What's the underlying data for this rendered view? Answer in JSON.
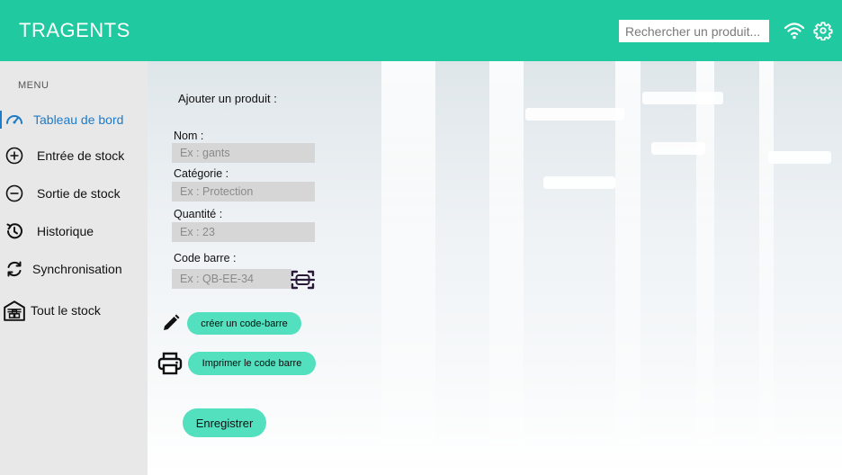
{
  "app": {
    "title": "TRAGENTS"
  },
  "header": {
    "search_placeholder": "Rechercher un produit...",
    "wifi_icon": "wifi-icon",
    "settings_icon": "gear-icon"
  },
  "sidebar": {
    "menu_title": "MENU",
    "items": [
      {
        "label": "Tableau de bord",
        "icon": "dashboard-gauge-icon",
        "active": true
      },
      {
        "label": "Entrée de stock",
        "icon": "plus-circle-icon"
      },
      {
        "label": "Sortie de stock",
        "icon": "minus-circle-icon"
      },
      {
        "label": "Historique",
        "icon": "history-icon"
      },
      {
        "label": "Synchronisation",
        "icon": "sync-icon"
      },
      {
        "label": "Tout le stock",
        "icon": "warehouse-icon"
      }
    ]
  },
  "form": {
    "title": "Ajouter un produit :",
    "name_label": "Nom :",
    "name_placeholder": "Ex : gants",
    "category_label": "Catégorie :",
    "category_placeholder": "Ex : Protection",
    "quantity_label": "Quantité :",
    "quantity_placeholder": "Ex : 23",
    "barcode_label": "Code barre :",
    "barcode_placeholder": "Ex : QB-EE-34",
    "create_barcode_label": "créer un code-barre",
    "print_barcode_label": "Imprimer le code barre",
    "save_label": "Enregistrer"
  },
  "colors": {
    "header": "#20c9a0",
    "sidebar": "#e8e8e8",
    "active_nav": "#1e7bc8",
    "button": "#52e0bf",
    "field": "#d6d6d6"
  }
}
